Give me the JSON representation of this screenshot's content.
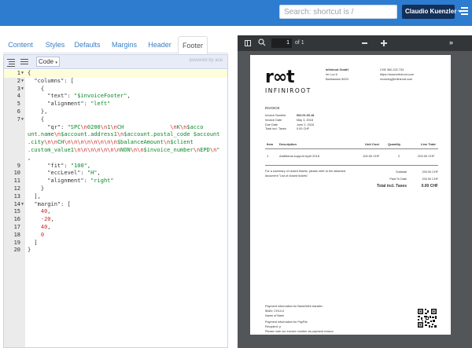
{
  "topbar": {
    "search_placeholder": "Search: shortcut is /",
    "user_label": "Claudio Kuenzler"
  },
  "tabs": [
    {
      "label": "Content"
    },
    {
      "label": "Styles"
    },
    {
      "label": "Defaults"
    },
    {
      "label": "Margins"
    },
    {
      "label": "Header"
    },
    {
      "label": "Footer",
      "active": true
    }
  ],
  "editor": {
    "mode_label": "Code",
    "powered_by": "powered by ace",
    "line_numbers": [
      "1",
      "2",
      "3",
      "4",
      "5",
      "6",
      "7",
      "",
      "",
      "",
      "",
      "8",
      "9",
      "10",
      "11",
      "12",
      "13",
      "14",
      "15",
      "16",
      "17",
      "18",
      "19",
      "20"
    ]
  },
  "viewer": {
    "page_current": "1",
    "page_of": "of 1"
  },
  "invoice": {
    "logo_mark": "r∞t",
    "logo_text": "INFINIROOT",
    "address": [
      "Infiniroot GmbH",
      "Im Loo 6",
      "Badhausen 8003"
    ],
    "contact": [
      "CHE 960.222.733",
      "https://www.infiniroot.com",
      "invoicing@infiniroot.com"
    ],
    "title": "INVOICE",
    "meta": [
      {
        "label": "Invoice Number",
        "value": "002.01.00.18"
      },
      {
        "label": "Invoice Date",
        "value": "May 3, 2018"
      },
      {
        "label": "Due Date",
        "value": "June 2, 2018"
      },
      {
        "label": "Total incl. Taxes",
        "value": "0.00 CHF"
      }
    ],
    "headers": {
      "item": "Item",
      "desc": "Description",
      "unit": "Unit Cost",
      "qty": "Quantity",
      "total": "Line Total"
    },
    "row": {
      "item": "1",
      "desc": "Additional support April 2018",
      "unit": "100.00 CHF",
      "qty": "2",
      "total": "200.00 CHF"
    },
    "note": [
      "For a summary of closed tickets, please refer to the attached",
      "document \"List of closed tickets\"."
    ],
    "totals": [
      {
        "label": "Subtotal",
        "value": "200.00 CHF"
      },
      {
        "label": "Paid To Date",
        "value": "200.00 CHF"
      }
    ],
    "grand_label": "Total incl. Taxes",
    "grand_value": "0.00 CHF",
    "footer": [
      "Payment information for Bank/Wire transfer:",
      "IBAN: CH14-0",
      "Name of Bank",
      "",
      "Payment information for PayPal:",
      "Recipient: p",
      "Please note our invoice number as payment reason"
    ]
  }
}
